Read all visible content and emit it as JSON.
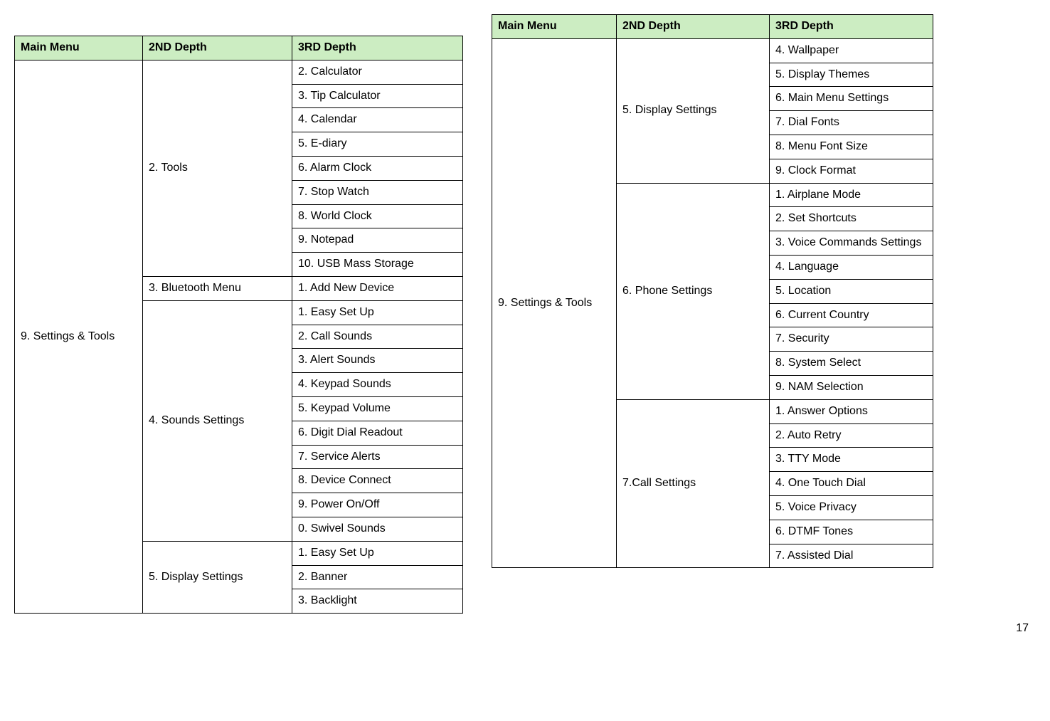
{
  "headers": {
    "main": "Main Menu",
    "second": "2ND Depth",
    "third": "3RD Depth"
  },
  "left": {
    "main": "9. Settings & Tools",
    "groups": {
      "tools": {
        "label": "2. Tools",
        "items": [
          "2. Calculator",
          "3. Tip Calculator",
          "4. Calendar",
          "5. E-diary",
          "6. Alarm Clock",
          "7. Stop Watch",
          "8. World Clock",
          "9. Notepad",
          "10. USB Mass Storage"
        ]
      },
      "bluetooth": {
        "label": "3. Bluetooth Menu",
        "items": [
          "1. Add New Device"
        ]
      },
      "sounds": {
        "label": "4. Sounds Settings",
        "items": [
          "1. Easy Set Up",
          "2. Call Sounds",
          "3. Alert Sounds",
          "4. Keypad Sounds",
          "5. Keypad Volume",
          "6. Digit Dial Readout",
          "7. Service Alerts",
          "8. Device Connect",
          "9. Power On/Off",
          "0. Swivel Sounds"
        ]
      },
      "display": {
        "label": "5. Display Settings",
        "items": [
          "1. Easy Set Up",
          "2. Banner",
          "3. Backlight"
        ]
      }
    }
  },
  "right": {
    "main": "9. Settings & Tools",
    "groups": {
      "display": {
        "label": "5. Display Settings",
        "items": [
          "4. Wallpaper",
          "5. Display Themes",
          "6. Main Menu Settings",
          "7. Dial Fonts",
          "8. Menu Font Size",
          "9. Clock Format"
        ]
      },
      "phone": {
        "label": "6. Phone Settings",
        "items": [
          "1. Airplane Mode",
          "2. Set Shortcuts",
          "3. Voice Commands Settings",
          "4. Language",
          "5. Location",
          "6. Current Country",
          "7. Security",
          "8. System Select",
          "9. NAM Selection"
        ]
      },
      "call": {
        "label": "7.Call Settings",
        "items": [
          "1. Answer Options",
          "2. Auto Retry",
          "3. TTY Mode",
          "4. One Touch Dial",
          "5. Voice Privacy",
          "6. DTMF Tones",
          "7. Assisted Dial"
        ]
      }
    }
  },
  "page_number": "17"
}
